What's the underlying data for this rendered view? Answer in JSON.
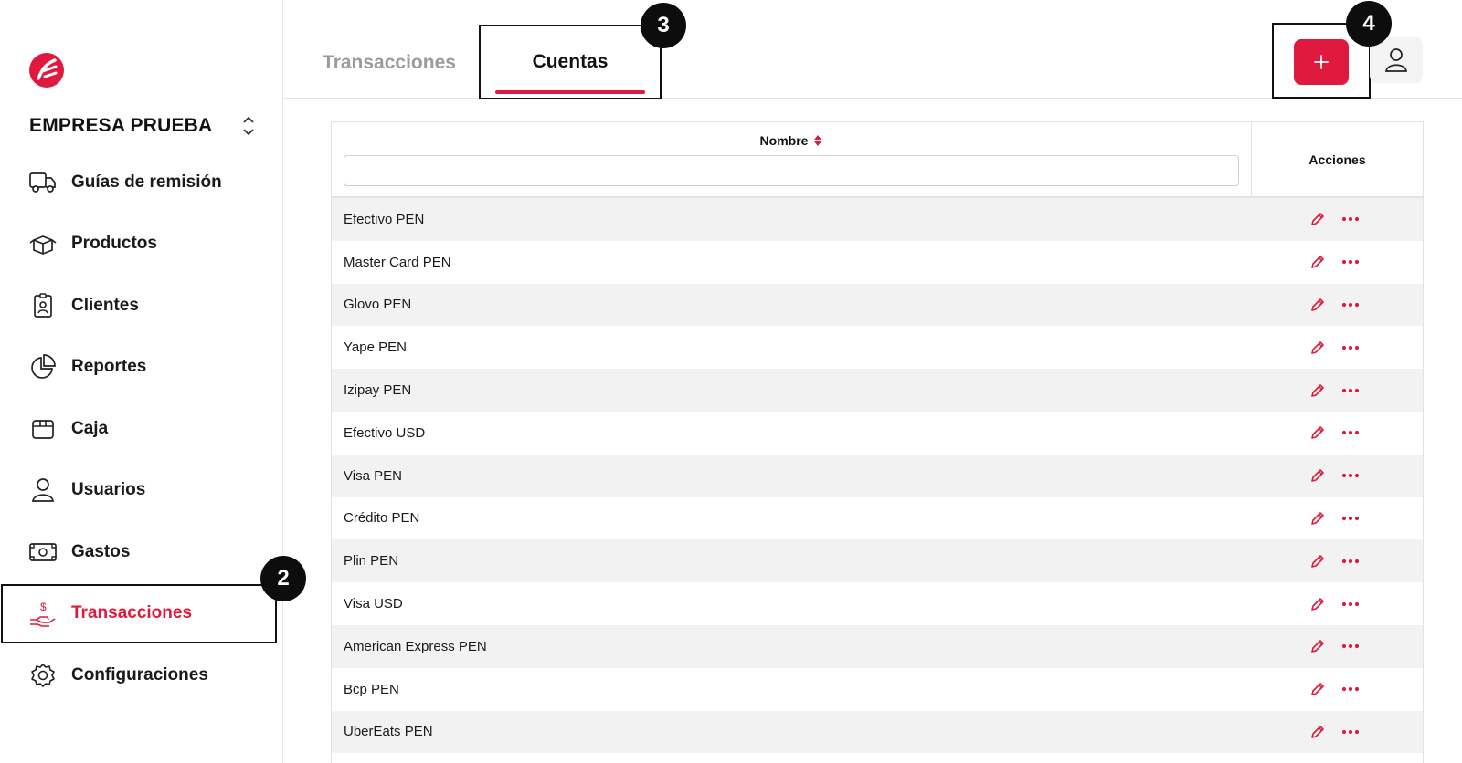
{
  "colors": {
    "accent": "#e0193f",
    "dark": "#111111",
    "stripe": "#f2f2f2"
  },
  "sidebar": {
    "company_name": "EMPRESA PRUEBA",
    "items": [
      {
        "label": "Guías de remisión",
        "icon": "truck-icon"
      },
      {
        "label": "Productos",
        "icon": "box-icon"
      },
      {
        "label": "Clientes",
        "icon": "id-badge-icon"
      },
      {
        "label": "Reportes",
        "icon": "pie-chart-icon"
      },
      {
        "label": "Caja",
        "icon": "cash-box-icon"
      },
      {
        "label": "Usuarios",
        "icon": "user-icon"
      },
      {
        "label": "Gastos",
        "icon": "banknote-icon"
      },
      {
        "label": "Transacciones",
        "icon": "hand-dollar-icon",
        "active": true
      },
      {
        "label": "Configuraciones",
        "icon": "gear-icon"
      }
    ]
  },
  "callouts": {
    "two": "2",
    "three": "3",
    "four": "4"
  },
  "header": {
    "tabs": [
      {
        "label": "Transacciones",
        "active": false
      },
      {
        "label": "Cuentas",
        "active": true
      }
    ]
  },
  "table": {
    "columns": {
      "name": "Nombre",
      "actions": "Acciones"
    },
    "filter_value": "",
    "rows": [
      "Efectivo PEN",
      "Master Card PEN",
      "Glovo PEN",
      "Yape PEN",
      "Izipay PEN",
      "Efectivo USD",
      "Visa PEN",
      "Crédito PEN",
      "Plin PEN",
      "Visa USD",
      "American Express PEN",
      "Bcp PEN",
      "UberEats PEN"
    ]
  }
}
